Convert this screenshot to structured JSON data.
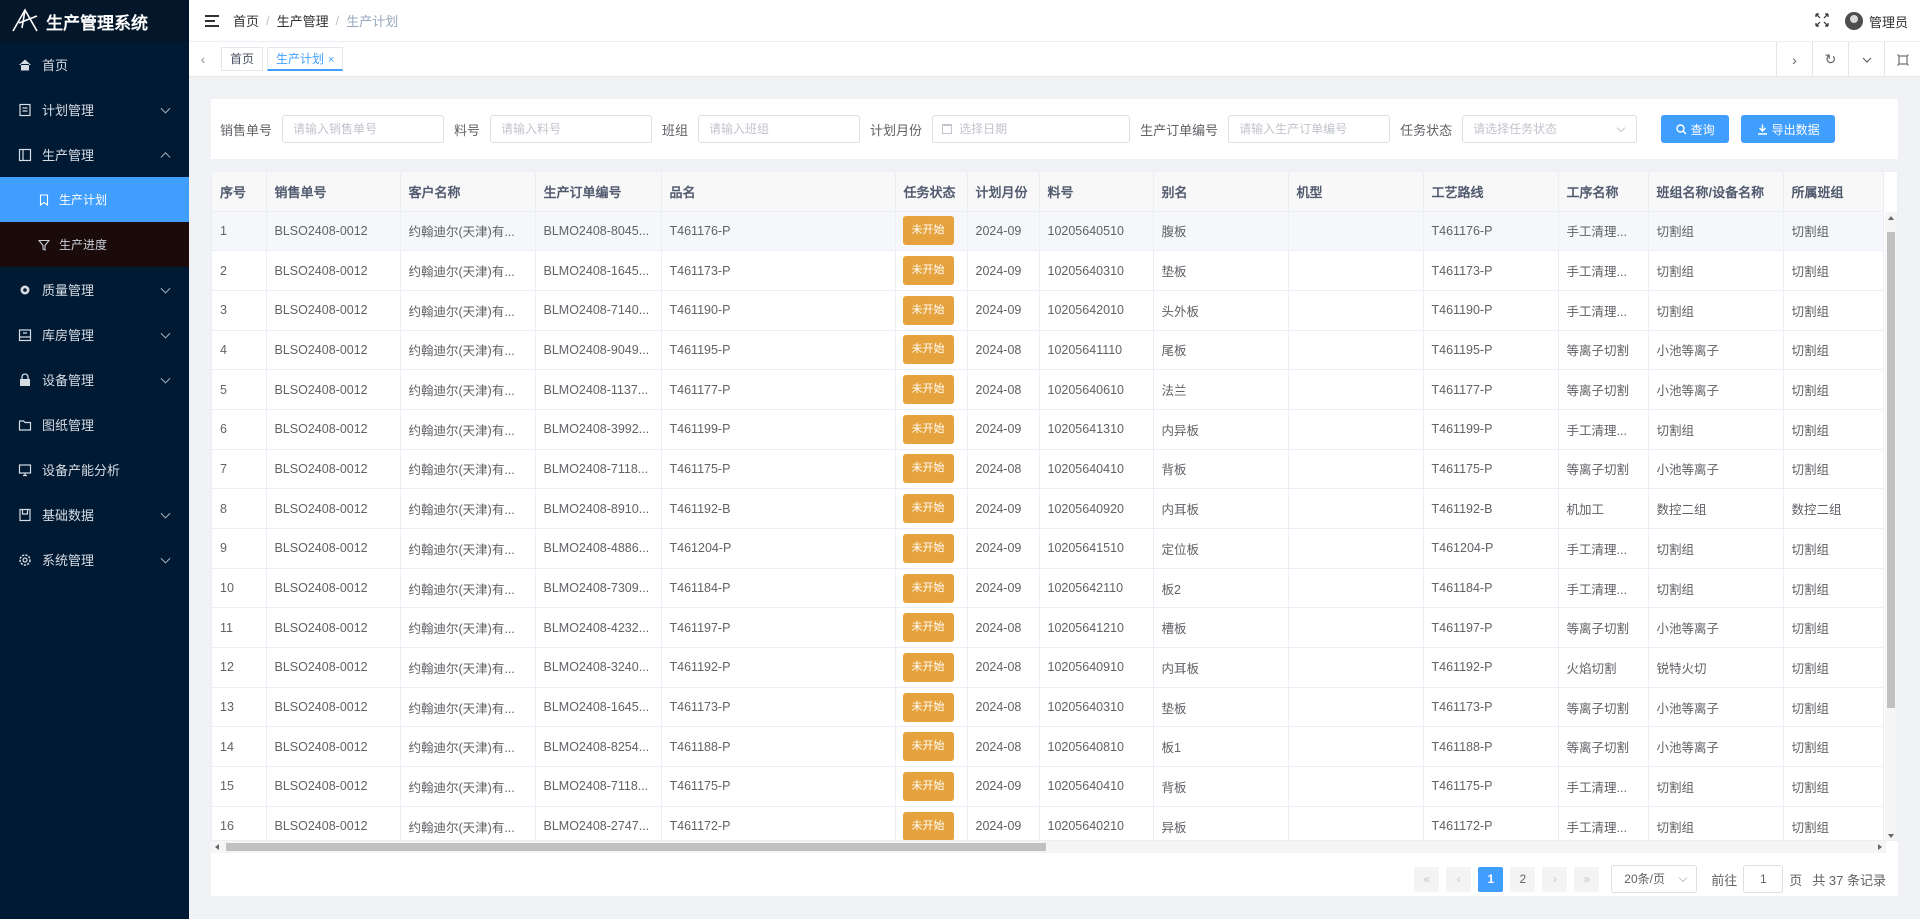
{
  "app": {
    "title": "生产管理系统"
  },
  "sidebar": {
    "items": [
      {
        "label": "首页",
        "icon": "home-icon",
        "expandable": false
      },
      {
        "label": "计划管理",
        "icon": "plan-icon",
        "expandable": true
      },
      {
        "label": "生产管理",
        "icon": "production-icon",
        "expandable": true,
        "expanded": true,
        "children": [
          {
            "label": "生产计划",
            "icon": "bookmark-icon",
            "active": true
          },
          {
            "label": "生产进度",
            "icon": "filter-icon",
            "active": false
          }
        ]
      },
      {
        "label": "质量管理",
        "icon": "gear-icon",
        "expandable": true
      },
      {
        "label": "库房管理",
        "icon": "warehouse-icon",
        "expandable": true
      },
      {
        "label": "设备管理",
        "icon": "lock-icon",
        "expandable": true
      },
      {
        "label": "图纸管理",
        "icon": "folder-icon",
        "expandable": false
      },
      {
        "label": "设备产能分析",
        "icon": "monitor-icon",
        "expandable": false
      },
      {
        "label": "基础数据",
        "icon": "database-icon",
        "expandable": true
      },
      {
        "label": "系统管理",
        "icon": "settings-icon",
        "expandable": true
      }
    ]
  },
  "header": {
    "breadcrumb": [
      "首页",
      "生产管理",
      "生产计划"
    ],
    "user": "管理员"
  },
  "tabs": [
    {
      "label": "首页",
      "active": false
    },
    {
      "label": "生产计划",
      "active": true,
      "close": "×"
    }
  ],
  "search": {
    "fields": [
      {
        "label": "销售单号",
        "placeholder": "请输入销售单号"
      },
      {
        "label": "料号",
        "placeholder": "请输入料号"
      },
      {
        "label": "班组",
        "placeholder": "请输入班组"
      },
      {
        "label": "计划月份",
        "placeholder": "选择日期"
      },
      {
        "label": "生产订单编号",
        "placeholder": "请输入生产订单编号"
      },
      {
        "label": "任务状态",
        "placeholder": "请选择任务状态"
      }
    ],
    "query_label": "查询",
    "export_label": "导出数据"
  },
  "table": {
    "columns": [
      "序号",
      "销售单号",
      "客户名称",
      "生产订单编号",
      "品名",
      "任务状态",
      "计划月份",
      "料号",
      "别名",
      "机型",
      "工艺路线",
      "工序名称",
      "班组名称/设备名称",
      "所属班组"
    ],
    "status_label": "未开始",
    "rows": [
      [
        "1",
        "BLSO2408-0012",
        "约翰迪尔(天津)有...",
        "BLMO2408-8045...",
        "T461176-P",
        "未开始",
        "2024-09",
        "10205640510",
        "腹板",
        "",
        "T461176-P",
        "手工清理...",
        "切割组",
        "切割组"
      ],
      [
        "2",
        "BLSO2408-0012",
        "约翰迪尔(天津)有...",
        "BLMO2408-1645...",
        "T461173-P",
        "未开始",
        "2024-09",
        "10205640310",
        "垫板",
        "",
        "T461173-P",
        "手工清理...",
        "切割组",
        "切割组"
      ],
      [
        "3",
        "BLSO2408-0012",
        "约翰迪尔(天津)有...",
        "BLMO2408-7140...",
        "T461190-P",
        "未开始",
        "2024-09",
        "10205642010",
        "头外板",
        "",
        "T461190-P",
        "手工清理...",
        "切割组",
        "切割组"
      ],
      [
        "4",
        "BLSO2408-0012",
        "约翰迪尔(天津)有...",
        "BLMO2408-9049...",
        "T461195-P",
        "未开始",
        "2024-08",
        "10205641110",
        "尾板",
        "",
        "T461195-P",
        "等离子切割",
        "小池等离子",
        "切割组"
      ],
      [
        "5",
        "BLSO2408-0012",
        "约翰迪尔(天津)有...",
        "BLMO2408-1137...",
        "T461177-P",
        "未开始",
        "2024-08",
        "10205640610",
        "法兰",
        "",
        "T461177-P",
        "等离子切割",
        "小池等离子",
        "切割组"
      ],
      [
        "6",
        "BLSO2408-0012",
        "约翰迪尔(天津)有...",
        "BLMO2408-3992...",
        "T461199-P",
        "未开始",
        "2024-09",
        "10205641310",
        "内异板",
        "",
        "T461199-P",
        "手工清理...",
        "切割组",
        "切割组"
      ],
      [
        "7",
        "BLSO2408-0012",
        "约翰迪尔(天津)有...",
        "BLMO2408-7118...",
        "T461175-P",
        "未开始",
        "2024-08",
        "10205640410",
        "背板",
        "",
        "T461175-P",
        "等离子切割",
        "小池等离子",
        "切割组"
      ],
      [
        "8",
        "BLSO2408-0012",
        "约翰迪尔(天津)有...",
        "BLMO2408-8910...",
        "T461192-B",
        "未开始",
        "2024-09",
        "10205640920",
        "内耳板",
        "",
        "T461192-B",
        "机加工",
        "数控二组",
        "数控二组"
      ],
      [
        "9",
        "BLSO2408-0012",
        "约翰迪尔(天津)有...",
        "BLMO2408-4886...",
        "T461204-P",
        "未开始",
        "2024-09",
        "10205641510",
        "定位板",
        "",
        "T461204-P",
        "手工清理...",
        "切割组",
        "切割组"
      ],
      [
        "10",
        "BLSO2408-0012",
        "约翰迪尔(天津)有...",
        "BLMO2408-7309...",
        "T461184-P",
        "未开始",
        "2024-09",
        "10205642110",
        "板2",
        "",
        "T461184-P",
        "手工清理...",
        "切割组",
        "切割组"
      ],
      [
        "11",
        "BLSO2408-0012",
        "约翰迪尔(天津)有...",
        "BLMO2408-4232...",
        "T461197-P",
        "未开始",
        "2024-08",
        "10205641210",
        "槽板",
        "",
        "T461197-P",
        "等离子切割",
        "小池等离子",
        "切割组"
      ],
      [
        "12",
        "BLSO2408-0012",
        "约翰迪尔(天津)有...",
        "BLMO2408-3240...",
        "T461192-P",
        "未开始",
        "2024-08",
        "10205640910",
        "内耳板",
        "",
        "T461192-P",
        "火焰切割",
        "锐特火切",
        "切割组"
      ],
      [
        "13",
        "BLSO2408-0012",
        "约翰迪尔(天津)有...",
        "BLMO2408-1645...",
        "T461173-P",
        "未开始",
        "2024-08",
        "10205640310",
        "垫板",
        "",
        "T461173-P",
        "等离子切割",
        "小池等离子",
        "切割组"
      ],
      [
        "14",
        "BLSO2408-0012",
        "约翰迪尔(天津)有...",
        "BLMO2408-8254...",
        "T461188-P",
        "未开始",
        "2024-08",
        "10205640810",
        "板1",
        "",
        "T461188-P",
        "等离子切割",
        "小池等离子",
        "切割组"
      ],
      [
        "15",
        "BLSO2408-0012",
        "约翰迪尔(天津)有...",
        "BLMO2408-7118...",
        "T461175-P",
        "未开始",
        "2024-09",
        "10205640410",
        "背板",
        "",
        "T461175-P",
        "手工清理...",
        "切割组",
        "切割组"
      ],
      [
        "16",
        "BLSO2408-0012",
        "约翰迪尔(天津)有...",
        "BLMO2408-2747...",
        "T461172-P",
        "未开始",
        "2024-09",
        "10205640210",
        "异板",
        "",
        "T461172-P",
        "手工清理...",
        "切割组",
        "切割组"
      ]
    ]
  },
  "pagination": {
    "pages": [
      "1",
      "2"
    ],
    "current": "1",
    "page_size": "20条/页",
    "goto_label": "前往",
    "goto_value": "1",
    "page_unit": "页",
    "total": "共 37 条记录"
  },
  "colors": {
    "primary": "#409eff",
    "sidebar_bg": "#011a33",
    "status_tag": "#e6a23c"
  }
}
